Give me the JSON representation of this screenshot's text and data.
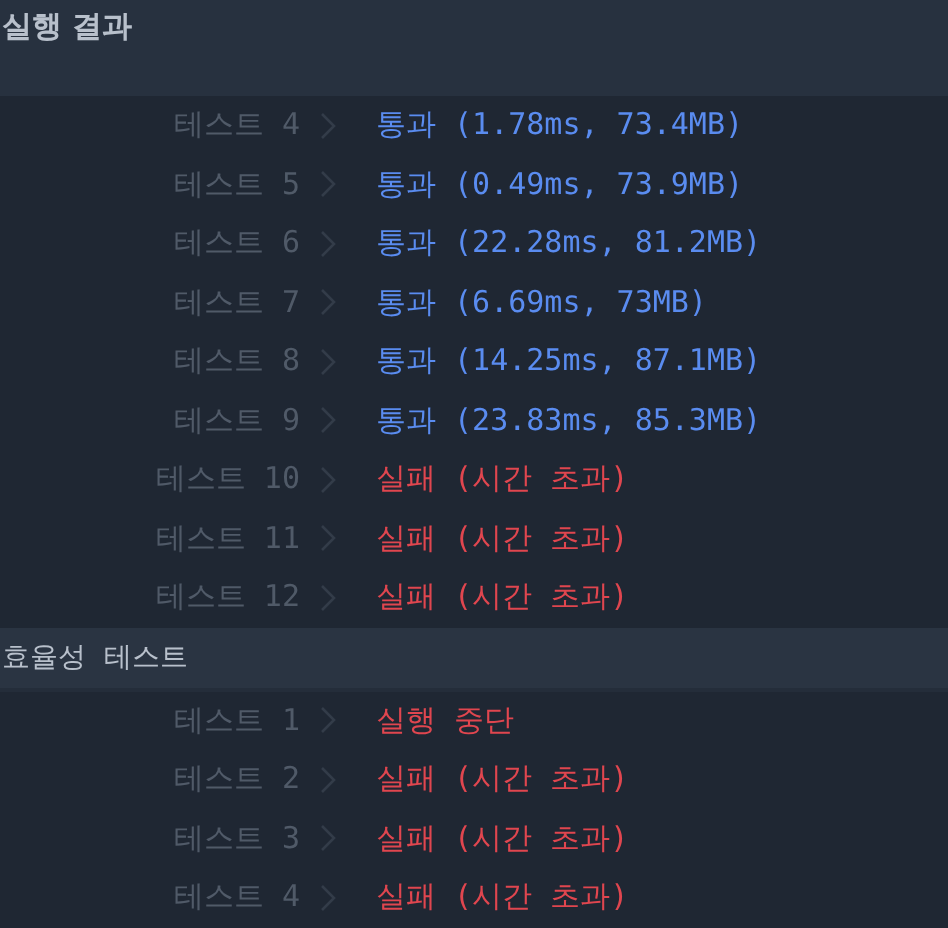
{
  "title": "실행 결과",
  "sections": [
    {
      "rows": [
        {
          "label": "테스트 4",
          "kind": "pass",
          "result": "통과 (1.78ms, 73.4MB)"
        },
        {
          "label": "테스트 5",
          "kind": "pass",
          "result": "통과 (0.49ms, 73.9MB)"
        },
        {
          "label": "테스트 6",
          "kind": "pass",
          "result": "통과 (22.28ms, 81.2MB)"
        },
        {
          "label": "테스트 7",
          "kind": "pass",
          "result": "통과 (6.69ms, 73MB)"
        },
        {
          "label": "테스트 8",
          "kind": "pass",
          "result": "통과 (14.25ms, 87.1MB)"
        },
        {
          "label": "테스트 9",
          "kind": "pass",
          "result": "통과 (23.83ms, 85.3MB)"
        },
        {
          "label": "테스트 10",
          "kind": "fail",
          "result": "실패 (시간 초과)"
        },
        {
          "label": "테스트 11",
          "kind": "fail",
          "result": "실패 (시간 초과)"
        },
        {
          "label": "테스트 12",
          "kind": "fail",
          "result": "실패 (시간 초과)"
        }
      ]
    },
    {
      "heading": "효율성  테스트",
      "rows": [
        {
          "label": "테스트 1",
          "kind": "fail",
          "result": "실행 중단"
        },
        {
          "label": "테스트 2",
          "kind": "fail",
          "result": "실패 (시간 초과)"
        },
        {
          "label": "테스트 3",
          "kind": "fail",
          "result": "실패 (시간 초과)"
        },
        {
          "label": "테스트 4",
          "kind": "fail",
          "result": "실패 (시간 초과)"
        }
      ]
    }
  ]
}
